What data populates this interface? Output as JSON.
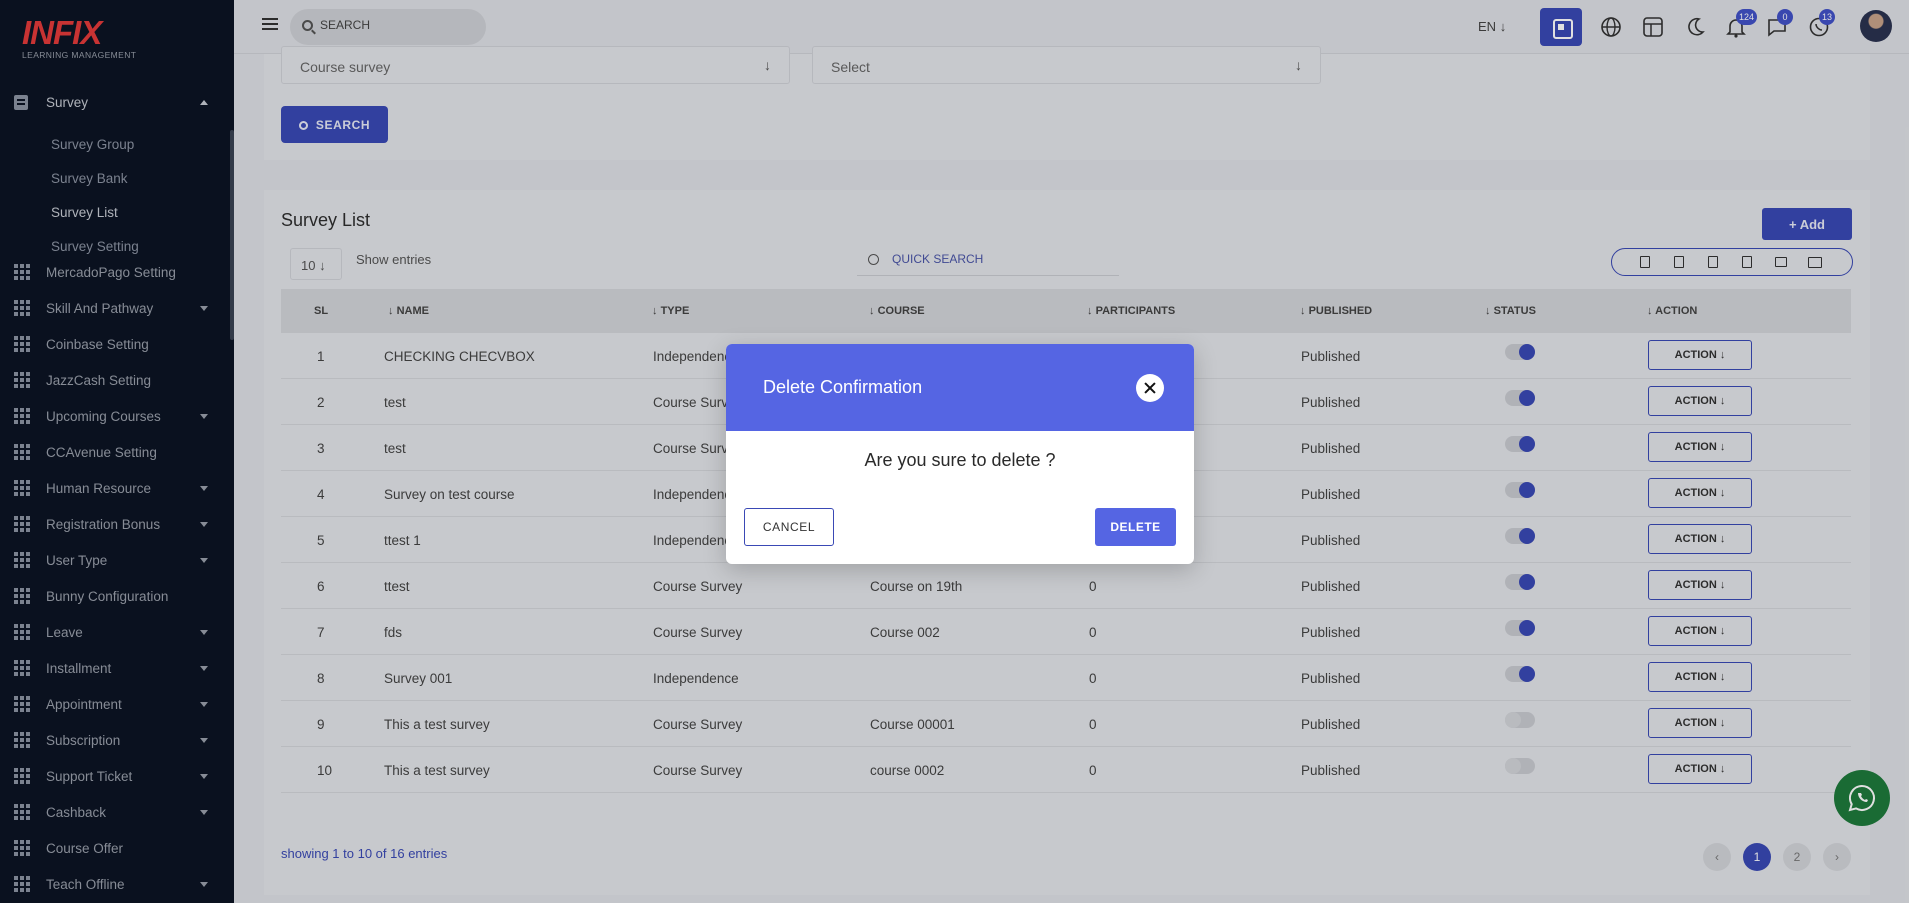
{
  "logo": {
    "brand": "INFIX",
    "tagline": "LEARNING MANAGEMENT"
  },
  "sidebar": {
    "survey_label": "Survey",
    "sub_items": [
      "Survey Group",
      "Survey Bank",
      "Survey List",
      "Survey Setting"
    ],
    "items": [
      {
        "label": "MercadoPago Setting",
        "caret": false
      },
      {
        "label": "Skill And Pathway",
        "caret": true
      },
      {
        "label": "Coinbase Setting",
        "caret": false
      },
      {
        "label": "JazzCash Setting",
        "caret": false
      },
      {
        "label": "Upcoming Courses",
        "caret": true
      },
      {
        "label": "CCAvenue Setting",
        "caret": false
      },
      {
        "label": "Human Resource",
        "caret": true
      },
      {
        "label": "Registration Bonus",
        "caret": true
      },
      {
        "label": "User Type",
        "caret": true
      },
      {
        "label": "Bunny Configuration",
        "caret": false
      },
      {
        "label": "Leave",
        "caret": true
      },
      {
        "label": "Installment",
        "caret": true
      },
      {
        "label": "Appointment",
        "caret": true
      },
      {
        "label": "Subscription",
        "caret": true
      },
      {
        "label": "Support Ticket",
        "caret": true
      },
      {
        "label": "Cashback",
        "caret": true
      },
      {
        "label": "Course Offer",
        "caret": false
      },
      {
        "label": "Teach Offline",
        "caret": true
      }
    ]
  },
  "topbar": {
    "search_placeholder": "SEARCH",
    "lang": "EN",
    "notif_count": "124",
    "message_count": "0",
    "chat_count": "13"
  },
  "filters": {
    "survey_select": "Course survey",
    "second_select": "Select",
    "search_button": "SEARCH"
  },
  "list": {
    "title": "Survey List",
    "add_button": "Add",
    "entries_value": "10",
    "show_entries": "Show entries",
    "quick_search_placeholder": "QUICK SEARCH",
    "headers": {
      "sl": "SL",
      "name": "NAME",
      "type": "TYPE",
      "course": "COURSE",
      "participants": "PARTICIPANTS",
      "published": "PUBLISHED",
      "status": "STATUS",
      "action": "ACTION"
    },
    "rows": [
      {
        "sl": "1",
        "name": "CHECKING CHECVBOX",
        "type": "Independence",
        "course": "",
        "participants": "",
        "published": "Published",
        "status": true
      },
      {
        "sl": "2",
        "name": "test",
        "type": "Course Survey",
        "course": "",
        "participants": "",
        "published": "Published",
        "status": true
      },
      {
        "sl": "3",
        "name": "test",
        "type": "Course Survey",
        "course": "",
        "participants": "",
        "published": "Published",
        "status": true
      },
      {
        "sl": "4",
        "name": "Survey on test course",
        "type": "Independence",
        "course": "",
        "participants": "",
        "published": "Published",
        "status": true
      },
      {
        "sl": "5",
        "name": "ttest 1",
        "type": "Independence",
        "course": "",
        "participants": "",
        "published": "Published",
        "status": true
      },
      {
        "sl": "6",
        "name": "ttest",
        "type": "Course Survey",
        "course": "Course on 19th",
        "participants": "0",
        "published": "Published",
        "status": true
      },
      {
        "sl": "7",
        "name": "fds",
        "type": "Course Survey",
        "course": "Course 002",
        "participants": "0",
        "published": "Published",
        "status": true
      },
      {
        "sl": "8",
        "name": "Survey 001",
        "type": "Independence",
        "course": "",
        "participants": "0",
        "published": "Published",
        "status": true
      },
      {
        "sl": "9",
        "name": "This a test survey",
        "type": "Course Survey",
        "course": "Course 00001",
        "participants": "0",
        "published": "Published",
        "status": false
      },
      {
        "sl": "10",
        "name": "This a test survey",
        "type": "Course Survey",
        "course": "course 0002",
        "participants": "0",
        "published": "Published",
        "status": false
      }
    ],
    "action_label": "ACTION",
    "showing": "showing 1 to 10 of 16 entries",
    "pages": [
      "1",
      "2"
    ]
  },
  "modal": {
    "title": "Delete Confirmation",
    "question": "Are you sure to delete ?",
    "cancel": "CANCEL",
    "delete": "DELETE"
  },
  "colors": {
    "primary": "#3a49b5",
    "modal_header": "#5565e3",
    "sidebar_bg": "#0c1424",
    "logo_red": "#e43b3b",
    "whatsapp": "#1e7a3c"
  }
}
